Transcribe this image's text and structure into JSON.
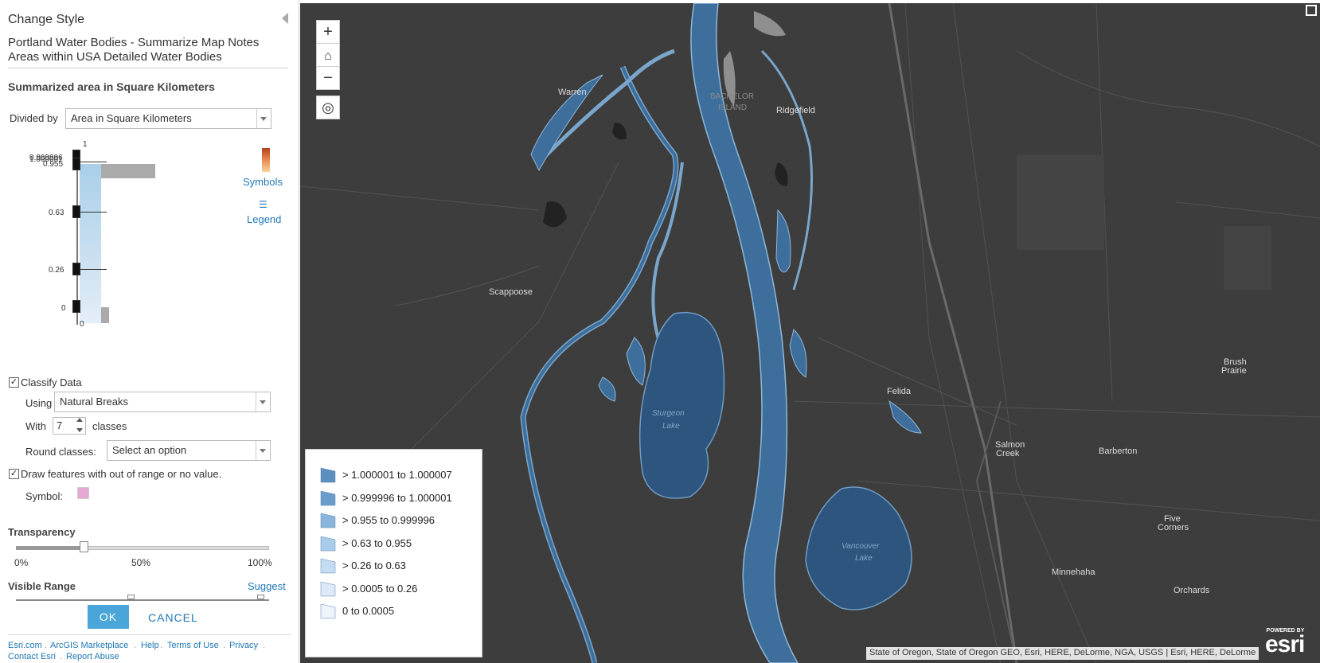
{
  "panel": {
    "title": "Change Style",
    "layer_title": "Portland Water Bodies - Summarize Map Notes Areas within USA Detailed Water Bodies",
    "section_heading": "Summarized area in Square Kilometers",
    "divided_by_label": "Divided by",
    "divided_by_value": "Area in Square Kilometers",
    "histogram": {
      "top_label": "1",
      "bottom_label": "0",
      "overlapping_label_a": "0.999996",
      "overlapping_label_b": "1.000001",
      "breaks": [
        "0.955",
        "0.63",
        "0.26",
        "0"
      ]
    },
    "symbols_link": "Symbols",
    "legend_link": "Legend",
    "classify_label": "Classify Data",
    "classify_checked": true,
    "using_label": "Using",
    "method_value": "Natural Breaks",
    "with_label": "With",
    "classes_value": "7",
    "classes_label": "classes",
    "round_label": "Round classes:",
    "round_placeholder": "Select an option",
    "outrange_label": "Draw features with out of range or no value.",
    "outrange_checked": true,
    "symbol_label": "Symbol:",
    "symbol_color": "#e7a8d6",
    "transparency_heading": "Transparency",
    "transparency_value_pct": 25,
    "transparency_ticks": [
      "0%",
      "50%",
      "100%"
    ],
    "visible_range_heading": "Visible Range",
    "suggest_link": "Suggest",
    "ok_label": "OK",
    "cancel_label": "CANCEL",
    "footer_links": [
      "Esri.com",
      "ArcGIS Marketplace",
      "Help",
      "Terms of Use",
      "Privacy",
      "Contact Esri",
      "Report Abuse"
    ]
  },
  "map": {
    "zoom_in": "+",
    "zoom_out": "−",
    "places": [
      "Warren",
      "BACHELOR",
      "ISLAND",
      "Ridgefield",
      "Scappoose",
      "Felida",
      "Salmon",
      "Creek",
      "Barberton",
      "Brush",
      "Prairie",
      "Five",
      "Corners",
      "Minnehaha",
      "Orchards"
    ],
    "water_labels": [
      "Sturgeon",
      "Lake",
      "Vancouver",
      "Lake"
    ],
    "legend": [
      {
        "label": "> 1.000001 to 1.000007",
        "color": "#5a8fc0"
      },
      {
        "label": "> 0.999996 to 1.000001",
        "color": "#6a9dcb"
      },
      {
        "label": "> 0.955 to 0.999996",
        "color": "#89b5dc"
      },
      {
        "label": "> 0.63 to 0.955",
        "color": "#a9cce9"
      },
      {
        "label": "> 0.26 to 0.63",
        "color": "#c4dcf0"
      },
      {
        "label": "> 0.0005 to 0.26",
        "color": "#dde9f6"
      },
      {
        "label": "0 to 0.0005",
        "color": "#eef3fa"
      }
    ],
    "attribution": "State of Oregon, State of Oregon GEO, Esri, HERE, DeLorme, NGA, USGS | Esri, HERE, DeLorme",
    "logo_powered": "POWERED BY",
    "logo_word": "esri"
  }
}
